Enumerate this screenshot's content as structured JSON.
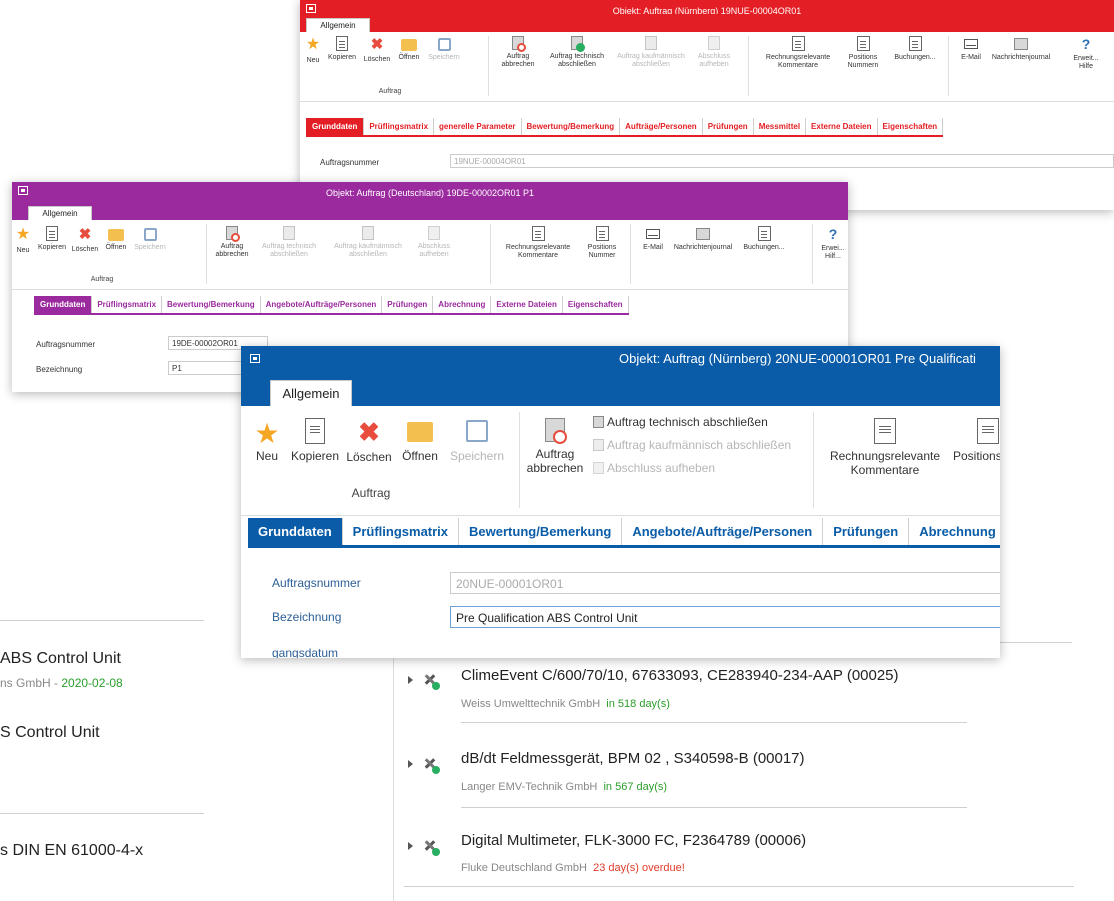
{
  "red_window": {
    "title": "Objekt: Auftrag (Nürnberg) 19NUE-00004OR01",
    "tab_allgemein": "Allgemein",
    "buttons": {
      "neu": "Neu",
      "kopieren": "Kopieren",
      "loeschen": "Löschen",
      "oeffnen": "Öffnen",
      "speichern": "Speichern",
      "auftrag_abbrechen": "Auftrag abbrechen",
      "technisch": "Auftrag technisch abschließen",
      "kaufmaennisch": "Auftrag kaufmännisch abschließen",
      "abschluss": "Abschluss aufheben",
      "rechnungsrelevante": "Rechnungsrelevante Kommentare",
      "positions": "Positions Nummern",
      "buchungen": "Buchungen...",
      "email": "E-Mail",
      "nachrichtenjournal": "Nachrichtenjournal",
      "erweitert": "Erweit... Hilfe"
    },
    "group_label": "Auftrag",
    "tabs": [
      "Grunddaten",
      "Prüflingsmatrix",
      "generelle Parameter",
      "Bewertung/Bemerkung",
      "Aufträge/Personen",
      "Prüfungen",
      "Messmittel",
      "Externe Dateien",
      "Eigenschaften"
    ],
    "fields": [
      {
        "label": "Auftragsnummer",
        "value": "19NUE-00004OR01"
      }
    ],
    "accent": "#e31e24"
  },
  "purple_window": {
    "title": "Objekt: Auftrag (Deutschland) 19DE-00002OR01 P1",
    "tab_allgemein": "Allgemein",
    "buttons": {
      "neu": "Neu",
      "kopieren": "Kopieren",
      "loeschen": "Löschen",
      "oeffnen": "Öffnen",
      "speichern": "Speichern",
      "auftrag_abbrechen": "Auftrag abbrechen",
      "technisch": "Auftrag technisch abschließen",
      "kaufmaennisch": "Auftrag kaufmännisch abschließen",
      "abschluss": "Abschluss aufheben",
      "rechnungsrelevante": "Rechnungsrelevante Kommentare",
      "positions": "Positions Nummer",
      "email": "E-Mail",
      "nachrichtenjournal": "Nachrichtenjournal",
      "buchungen": "Buchungen...",
      "erweitert": "Erwei... Hilf..."
    },
    "group_label": "Auftrag",
    "tabs": [
      "Grunddaten",
      "Prüflingsmatrix",
      "Bewertung/Bemerkung",
      "Angebote/Aufträge/Personen",
      "Prüfungen",
      "Abrechnung",
      "Externe Dateien",
      "Eigenschaften"
    ],
    "fields": [
      {
        "label": "Auftragsnummer",
        "value": "19DE-00002OR01"
      },
      {
        "label": "Bezeichnung",
        "value": "P1"
      }
    ],
    "accent": "#9b2a9e"
  },
  "blue_window": {
    "title": "Objekt: Auftrag (Nürnberg) 20NUE-00001OR01 Pre Qualificati",
    "tab_allgemein": "Allgemein",
    "buttons": {
      "neu": "Neu",
      "kopieren": "Kopieren",
      "loeschen": "Löschen",
      "oeffnen": "Öffnen",
      "speichern": "Speichern",
      "auftrag_abbrechen": "Auftrag abbrechen",
      "technisch": "Auftrag technisch abschließen",
      "kaufmaennisch": "Auftrag kaufmännisch abschließen",
      "abschluss": "Abschluss aufheben",
      "rechnungsrelevante": "Rechnungsrelevante Kommentare",
      "positions": "Positions-N"
    },
    "group_label": "Auftrag",
    "tabs": [
      "Grunddaten",
      "Prüflingsmatrix",
      "Bewertung/Bemerkung",
      "Angebote/Aufträge/Personen",
      "Prüfungen",
      "Abrechnung"
    ],
    "fields": [
      {
        "label": "Auftragsnummer",
        "value": "20NUE-00001OR01"
      },
      {
        "label": "Bezeichnung",
        "value": "Pre Qualification ABS Control Unit"
      },
      {
        "label": "gangsdatum",
        "value": ""
      }
    ],
    "accent": "#0a5ca8"
  },
  "left_list": {
    "items": [
      {
        "title": "ABS Control Unit",
        "sub_company": "ns GmbH - ",
        "sub_date": "2020-02-08"
      },
      {
        "title": "S Control Unit",
        "sub_company": "",
        "sub_date": ""
      },
      {
        "title": "s DIN EN 61000-4-x",
        "sub_company": "",
        "sub_date": ""
      }
    ]
  },
  "right_list": {
    "items": [
      {
        "title": "ClimeEvent C/600/70/10, 67633093, CE283940-234-AAP (00025)",
        "company": "Weiss Umwelttechnik GmbH",
        "status": "in 518 day(s)",
        "status_type": "ok"
      },
      {
        "title": "dB/dt Feldmessgerät, BPM 02 , S340598-B (00017)",
        "company": "Langer EMV-Technik GmbH",
        "status": "in 567 day(s)",
        "status_type": "ok"
      },
      {
        "title": "Digital Multimeter, FLK-3000 FC, F2364789 (00006)",
        "company": "Fluke Deutschland GmbH",
        "status": "23 day(s) overdue!",
        "status_type": "overdue"
      }
    ]
  }
}
